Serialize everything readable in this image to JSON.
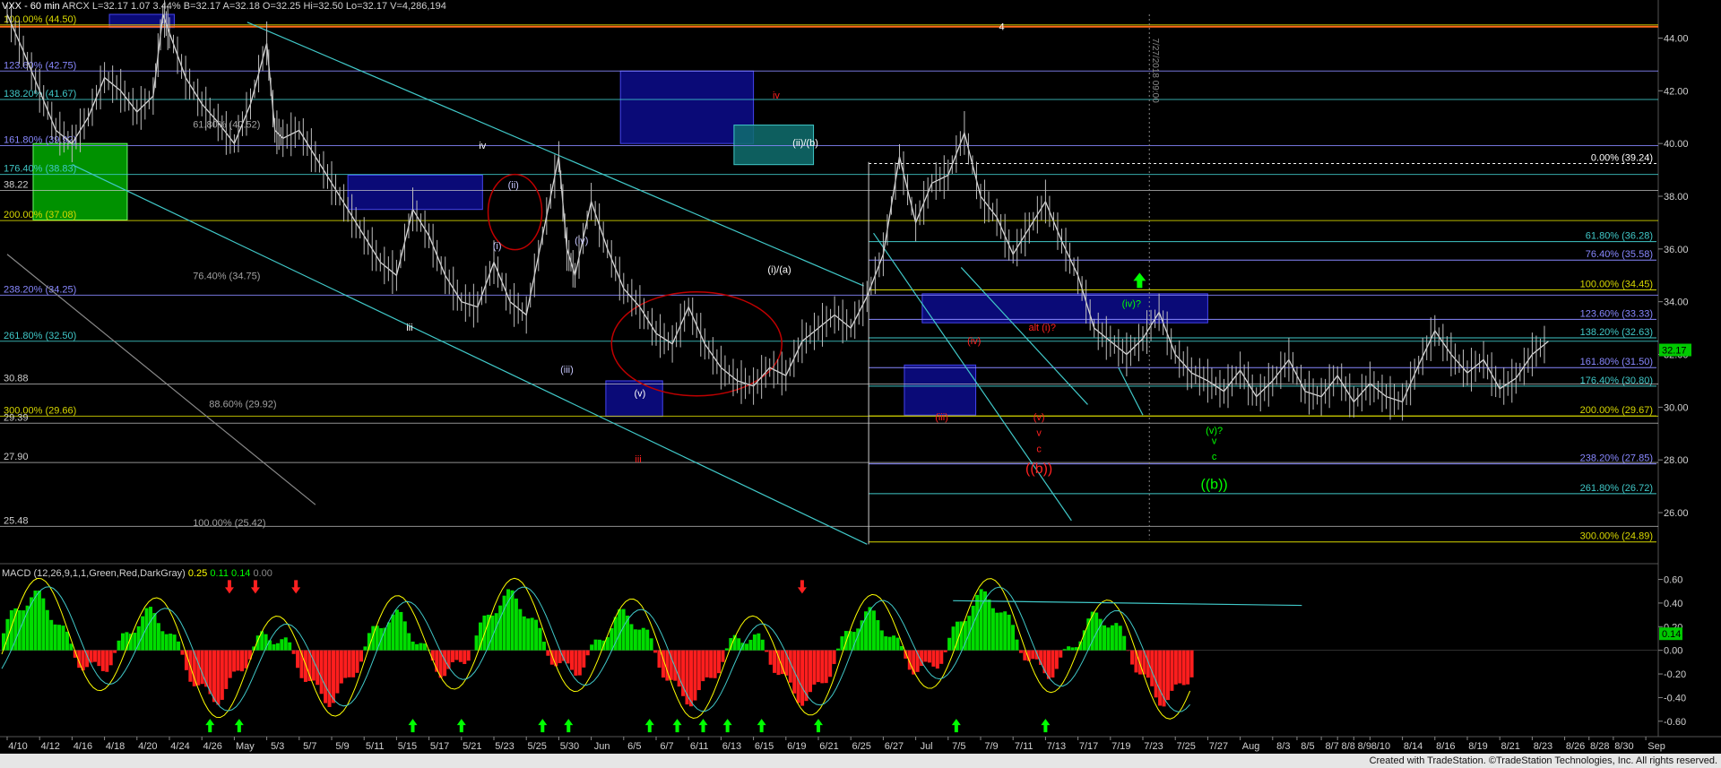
{
  "header": {
    "symbol": "VXX - 60 min",
    "exchange": "ARCX",
    "last": "L=32.17",
    "change": "1.07",
    "pct": "3.44%",
    "bid": "B=32.17",
    "ask": "A=32.18",
    "open": "O=32.25",
    "high": "Hi=32.50",
    "low": "Lo=32.17",
    "volume": "V=4,286,194"
  },
  "macd_header": {
    "label": "MACD (12,26,9,1,1,Green,Red,DarkGray)",
    "v1": "0.25",
    "v2": "0.11",
    "v3": "0.14",
    "v4": "0.00"
  },
  "footer": {
    "text": "Created with TradeStation. ©TradeStation Technologies, Inc. All rights reserved."
  },
  "chart_data": {
    "type": "line",
    "price_axis": {
      "ticks": [
        "44.00",
        "42.00",
        "40.00",
        "38.00",
        "36.00",
        "34.00",
        "32.00",
        "30.00",
        "28.00",
        "26.00"
      ],
      "ylim": [
        24.2,
        44.9
      ]
    },
    "macd_axis": {
      "ticks": [
        "0.60",
        "0.40",
        "0.20",
        "0.00",
        "-0.20",
        "-0.40",
        "-0.60"
      ],
      "ylim": [
        -0.7,
        0.68
      ]
    },
    "last_price_label": "32.17",
    "macd_last_label": "0.14",
    "colors": {
      "up": "#00ff00",
      "down": "#ff2a2a",
      "price": "#d8d8d8",
      "blue": "#1414aa",
      "green": "#00aa00",
      "cyan": "#40c8c8",
      "red": "#ff2020",
      "white": "#ffffff"
    },
    "x_labels": [
      "4/10",
      "4/12",
      "4/16",
      "4/18",
      "4/20",
      "4/24",
      "4/26",
      "May",
      "5/3",
      "5/7",
      "5/9",
      "5/11",
      "5/15",
      "5/17",
      "5/21",
      "5/23",
      "5/25",
      "5/30",
      "Jun",
      "6/5",
      "6/7",
      "6/11",
      "6/13",
      "6/15",
      "6/19",
      "6/21",
      "6/25",
      "6/27",
      "Jul",
      "7/5",
      "7/9",
      "7/11",
      "7/13",
      "7/17",
      "7/19",
      "7/23",
      "7/25",
      "7/27",
      "Aug",
      "8/3",
      "8/5",
      "8/7",
      "8/8",
      "8/9",
      "8/10",
      "8/14",
      "8/16",
      "8/19",
      "8/21",
      "8/23",
      "8/26",
      "8/28",
      "8/30",
      "Sep"
    ],
    "x_label_index": [
      0,
      2,
      4,
      6,
      8,
      10,
      12,
      14,
      16,
      18,
      20,
      22,
      24,
      26,
      28,
      30,
      32,
      34,
      36,
      38,
      40,
      42,
      44,
      46,
      48,
      50,
      52,
      54,
      56,
      58,
      60,
      62,
      64,
      66,
      68,
      70,
      72,
      74,
      76,
      78,
      79.5,
      81,
      82,
      83,
      84,
      86,
      88,
      90,
      92,
      94,
      96,
      97.5,
      99,
      101
    ],
    "price_path": [
      [
        0,
        44.9
      ],
      [
        1,
        43.5
      ],
      [
        2,
        42.0
      ],
      [
        3,
        40.5
      ],
      [
        4,
        40.0
      ],
      [
        5,
        41.0
      ],
      [
        6,
        42.5
      ],
      [
        7,
        42.0
      ],
      [
        8,
        41.2
      ],
      [
        9,
        41.8
      ],
      [
        9.6,
        44.9
      ],
      [
        10,
        44.2
      ],
      [
        11,
        42.5
      ],
      [
        12,
        41.5
      ],
      [
        13,
        40.8
      ],
      [
        14,
        40.0
      ],
      [
        15,
        41.5
      ],
      [
        16,
        43.8
      ],
      [
        16.5,
        40.5
      ],
      [
        17,
        40.2
      ],
      [
        18,
        40.5
      ],
      [
        19,
        39.5
      ],
      [
        20,
        38.5
      ],
      [
        21,
        37.5
      ],
      [
        22,
        36.5
      ],
      [
        23,
        35.5
      ],
      [
        24,
        35.0
      ],
      [
        25,
        37.5
      ],
      [
        26,
        36.5
      ],
      [
        27,
        35.0
      ],
      [
        28,
        34.0
      ],
      [
        29,
        33.8
      ],
      [
        30,
        35.5
      ],
      [
        31,
        34.0
      ],
      [
        32,
        33.5
      ],
      [
        33,
        36.5
      ],
      [
        34,
        39.5
      ],
      [
        34.5,
        36.0
      ],
      [
        35,
        35.0
      ],
      [
        36,
        37.8
      ],
      [
        37,
        36.0
      ],
      [
        38,
        34.5
      ],
      [
        39,
        33.8
      ],
      [
        40,
        32.8
      ],
      [
        41,
        32.4
      ],
      [
        42,
        33.8
      ],
      [
        43,
        32.4
      ],
      [
        44,
        31.5
      ],
      [
        45,
        31.0
      ],
      [
        46,
        30.8
      ],
      [
        47,
        31.5
      ],
      [
        48,
        31.2
      ],
      [
        49,
        32.5
      ],
      [
        50,
        33.0
      ],
      [
        51,
        33.5
      ],
      [
        52,
        33.0
      ],
      [
        53,
        34.2
      ],
      [
        54,
        35.8
      ],
      [
        55,
        39.5
      ],
      [
        56,
        37.0
      ],
      [
        57,
        38.5
      ],
      [
        58,
        38.8
      ],
      [
        59,
        40.4
      ],
      [
        60,
        38.0
      ],
      [
        61,
        37.2
      ],
      [
        62,
        35.8
      ],
      [
        63,
        36.8
      ],
      [
        64,
        37.8
      ],
      [
        65,
        36.3
      ],
      [
        66,
        35.0
      ],
      [
        67,
        33.0
      ],
      [
        68,
        32.5
      ],
      [
        69,
        32.0
      ],
      [
        70,
        32.6
      ],
      [
        71,
        33.6
      ],
      [
        72,
        32.0
      ],
      [
        73,
        31.3
      ],
      [
        74,
        31.0
      ],
      [
        75,
        30.6
      ],
      [
        76,
        31.4
      ],
      [
        77,
        30.4
      ],
      [
        78,
        31.0
      ],
      [
        79,
        31.8
      ],
      [
        80,
        30.6
      ],
      [
        81,
        30.4
      ],
      [
        82,
        31.2
      ],
      [
        83,
        30.2
      ],
      [
        84,
        30.9
      ],
      [
        85,
        30.4
      ],
      [
        86,
        30.2
      ],
      [
        87,
        31.6
      ],
      [
        88,
        32.9
      ],
      [
        89,
        32.0
      ],
      [
        90,
        31.3
      ],
      [
        91,
        31.8
      ],
      [
        92,
        30.7
      ],
      [
        93,
        31.1
      ],
      [
        94,
        32.0
      ],
      [
        95,
        32.5
      ]
    ],
    "fib_lines": [
      {
        "label": "100.00% (44.50)",
        "y": 44.5,
        "color": "#d8d800",
        "side": "left"
      },
      {
        "label": "123.60% (42.75)",
        "y": 42.75,
        "color": "#8888ff",
        "side": "left"
      },
      {
        "label": "138.20% (41.67)",
        "y": 41.67,
        "color": "#40c8c8",
        "side": "left"
      },
      {
        "label": "161.80% (39.92)",
        "y": 39.92,
        "color": "#8888ff",
        "side": "left"
      },
      {
        "label": "176.40% (38.83)",
        "y": 38.83,
        "color": "#40c8c8",
        "side": "left"
      },
      {
        "label": "200.00% (37.08)",
        "y": 37.08,
        "color": "#d8d800",
        "side": "left"
      },
      {
        "label": "238.20% (34.25)",
        "y": 34.25,
        "color": "#8888ff",
        "side": "left"
      },
      {
        "label": "261.80% (32.50)",
        "y": 32.5,
        "color": "#40c8c8",
        "side": "left"
      },
      {
        "label": "300.00% (29.66)",
        "y": 29.66,
        "color": "#d8d800",
        "side": "left"
      },
      {
        "label": "0.00% (39.24)",
        "y": 39.24,
        "color": "#ffffff",
        "side": "right"
      },
      {
        "label": "61.80% (36.28)",
        "y": 36.28,
        "color": "#40c8c8",
        "side": "right"
      },
      {
        "label": "76.40% (35.58)",
        "y": 35.58,
        "color": "#8888ff",
        "side": "right"
      },
      {
        "label": "100.00% (34.45)",
        "y": 34.45,
        "color": "#d8d800",
        "side": "right"
      },
      {
        "label": "123.60% (33.33)",
        "y": 33.33,
        "color": "#8888ff",
        "side": "right"
      },
      {
        "label": "138.20% (32.63)",
        "y": 32.63,
        "color": "#40c8c8",
        "side": "right"
      },
      {
        "label": "161.80% (31.50)",
        "y": 31.5,
        "color": "#8888ff",
        "side": "right"
      },
      {
        "label": "176.40% (30.80)",
        "y": 30.8,
        "color": "#40c8c8",
        "side": "right"
      },
      {
        "label": "200.00% (29.67)",
        "y": 29.67,
        "color": "#d8d800",
        "side": "right"
      },
      {
        "label": "238.20% (27.85)",
        "y": 27.85,
        "color": "#8888ff",
        "side": "right"
      },
      {
        "label": "261.80% (26.72)",
        "y": 26.72,
        "color": "#40c8c8",
        "side": "right"
      },
      {
        "label": "300.00% (24.89)",
        "y": 24.89,
        "color": "#d8d800",
        "side": "right"
      }
    ],
    "level_labels": [
      {
        "text": "38.22",
        "y": 38.22
      },
      {
        "text": "30.88",
        "y": 30.88
      },
      {
        "text": "29.39",
        "y": 29.39
      },
      {
        "text": "27.90",
        "y": 27.9
      },
      {
        "text": "25.48",
        "y": 25.48
      }
    ],
    "mid_fib_labels": [
      {
        "text": "61.80% (40.52)",
        "x": 12,
        "y": 40.6
      },
      {
        "text": "76.40% (34.75)",
        "x": 12,
        "y": 34.85
      },
      {
        "text": "88.60% (29.92)",
        "x": 13,
        "y": 30.0
      },
      {
        "text": "100.00% (25.42)",
        "x": 12,
        "y": 25.5
      }
    ],
    "boxes": [
      {
        "x0": 1.6,
        "x1": 7.4,
        "y0": 40.0,
        "y1": 37.1,
        "color": "green"
      },
      {
        "x0": 6.3,
        "x1": 10.3,
        "y0": 44.9,
        "y1": 44.4,
        "color": "blue"
      },
      {
        "x0": 21,
        "x1": 29.3,
        "y0": 38.8,
        "y1": 37.5,
        "color": "blue"
      },
      {
        "x0": 37.8,
        "x1": 46,
        "y0": 42.75,
        "y1": 40.0,
        "color": "blue"
      },
      {
        "x0": 44.8,
        "x1": 49.7,
        "y0": 40.7,
        "y1": 39.2,
        "color": "teal"
      },
      {
        "x0": 56.4,
        "x1": 74,
        "y0": 34.3,
        "y1": 33.2,
        "color": "blue"
      },
      {
        "x0": 36.9,
        "x1": 40.4,
        "y0": 31.0,
        "y1": 29.65,
        "color": "blue"
      },
      {
        "x0": 55.3,
        "x1": 59.7,
        "y0": 31.6,
        "y1": 29.7,
        "color": "blue"
      }
    ],
    "wave_labels": [
      {
        "text": "iv",
        "x": 29.3,
        "y": 39.8,
        "color": "#ffffff"
      },
      {
        "text": "iii",
        "x": 24.8,
        "y": 32.9,
        "color": "#ffffff"
      },
      {
        "text": "(ii)",
        "x": 31.2,
        "y": 38.3,
        "color": "#c8c8ff"
      },
      {
        "text": "(i)",
        "x": 30.2,
        "y": 36.0,
        "color": "#c8c8ff"
      },
      {
        "text": "(iv)",
        "x": 35.4,
        "y": 36.2,
        "color": "#c8c8ff"
      },
      {
        "text": "(iii)",
        "x": 34.5,
        "y": 31.3,
        "color": "#c8c8ff"
      },
      {
        "text": "(v)",
        "x": 39.0,
        "y": 30.4,
        "color": "#ffffff"
      },
      {
        "text": "iii",
        "x": 38.9,
        "y": 27.9,
        "color": "#ff2020"
      },
      {
        "text": "iv",
        "x": 47.4,
        "y": 41.7,
        "color": "#ff2020"
      },
      {
        "text": "(ii)/(b)",
        "x": 49.2,
        "y": 39.9,
        "color": "#ffffff"
      },
      {
        "text": "(i)/(a)",
        "x": 47.6,
        "y": 35.1,
        "color": "#ffffff"
      },
      {
        "text": "4",
        "x": 61.3,
        "y": 44.3,
        "color": "#ffffff"
      },
      {
        "text": "(iv)",
        "x": 59.6,
        "y": 32.4,
        "color": "#ff2020"
      },
      {
        "text": "(iii)",
        "x": 57.6,
        "y": 29.5,
        "color": "#ff2020"
      },
      {
        "text": "alt (i)?",
        "x": 63.8,
        "y": 32.9,
        "color": "#ff2020"
      },
      {
        "text": "(v)",
        "x": 63.6,
        "y": 29.5,
        "color": "#ff2020"
      },
      {
        "text": "v",
        "x": 63.6,
        "y": 28.9,
        "color": "#ff2020"
      },
      {
        "text": "c",
        "x": 63.6,
        "y": 28.3,
        "color": "#ff2020"
      },
      {
        "text": "((b))",
        "x": 63.6,
        "y": 27.5,
        "color": "#ff2020"
      },
      {
        "text": "(iv)?",
        "x": 69.3,
        "y": 33.8,
        "color": "#00ff00"
      },
      {
        "text": "(v)?",
        "x": 74.4,
        "y": 29.0,
        "color": "#00ff00"
      },
      {
        "text": "v",
        "x": 74.4,
        "y": 28.6,
        "color": "#00ff00"
      },
      {
        "text": "c",
        "x": 74.4,
        "y": 28.0,
        "color": "#00ff00"
      },
      {
        "text": "((b))",
        "x": 74.4,
        "y": 26.9,
        "color": "#00ff00"
      }
    ],
    "vertical_date_label": "7/27/2018 09:00",
    "macd_up_arrows": [
      12.5,
      14.3,
      25,
      28,
      33,
      34.6,
      39.6,
      41.3,
      42.9,
      44.4,
      46.5,
      50,
      58.5,
      64
    ],
    "macd_down_arrows": [
      13.7,
      15.3,
      17.8,
      49
    ],
    "grid": false,
    "legend": "none"
  }
}
